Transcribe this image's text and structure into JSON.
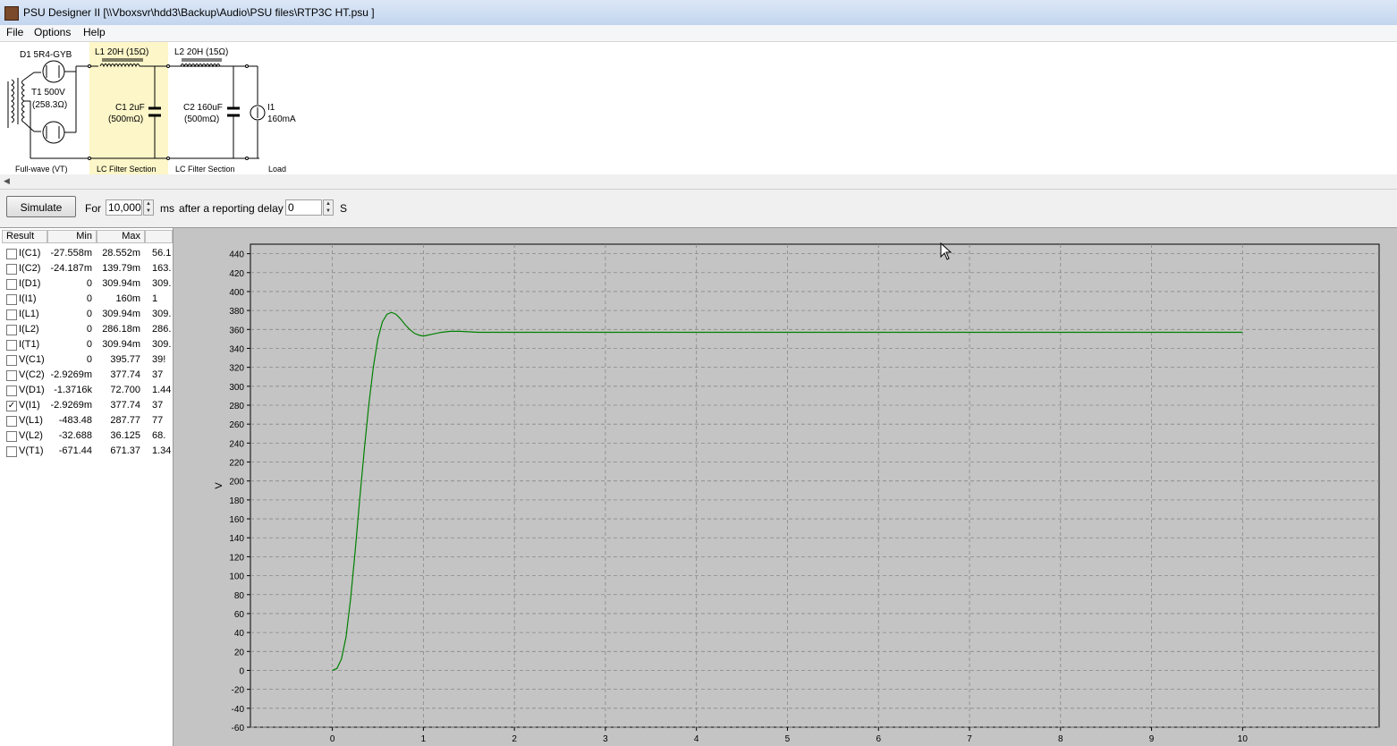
{
  "window": {
    "title": "PSU Designer II  [\\\\Vboxsvr\\hdd3\\Backup\\Audio\\PSU files\\RTP3C HT.psu ]",
    "icon": "app-icon"
  },
  "menu": [
    "File",
    "Options",
    "Help"
  ],
  "schematic": {
    "d1_label": "D1 5R4-GYB",
    "t1_label1": "T1 500V",
    "t1_label2": "(258.3Ω)",
    "l1_label": "L1 20H (15Ω)",
    "l2_label": "L2 20H (15Ω)",
    "c1_label1": "C1 2uF",
    "c1_label2": "(500mΩ)",
    "c2_label1": "C2 160uF",
    "c2_label2": "(500mΩ)",
    "i1_label1": "I1",
    "i1_label2": "160mA",
    "section_fullwave": "Full-wave (VT)",
    "section_lc1": "LC Filter Section",
    "section_lc2": "LC Filter Section",
    "section_load": "Load",
    "highlight_color": "#fcf6c8"
  },
  "toolbar": {
    "simulate_label": "Simulate",
    "for_label": "For",
    "duration_value": "10,000",
    "ms_label": "ms",
    "delay_label": "after a reporting delay of",
    "delay_value": "0",
    "s_label": "S"
  },
  "results": {
    "headers": [
      "Result",
      "Min",
      "Max"
    ],
    "rows": [
      {
        "name": "I(C1)",
        "min": "-27.558m",
        "max": "28.552m",
        "third": "56.1",
        "checked": false
      },
      {
        "name": "I(C2)",
        "min": "-24.187m",
        "max": "139.79m",
        "third": "163.",
        "checked": false
      },
      {
        "name": "I(D1)",
        "min": "0",
        "max": "309.94m",
        "third": "309.",
        "checked": false
      },
      {
        "name": "I(I1)",
        "min": "0",
        "max": "160m",
        "third": "1",
        "checked": false
      },
      {
        "name": "I(L1)",
        "min": "0",
        "max": "309.94m",
        "third": "309.",
        "checked": false
      },
      {
        "name": "I(L2)",
        "min": "0",
        "max": "286.18m",
        "third": "286.",
        "checked": false
      },
      {
        "name": "I(T1)",
        "min": "0",
        "max": "309.94m",
        "third": "309.",
        "checked": false
      },
      {
        "name": "V(C1)",
        "min": "0",
        "max": "395.77",
        "third": "39!",
        "checked": false
      },
      {
        "name": "V(C2)",
        "min": "-2.9269m",
        "max": "377.74",
        "third": "37",
        "checked": false
      },
      {
        "name": "V(D1)",
        "min": "-1.3716k",
        "max": "72.700",
        "third": "1.44",
        "checked": false
      },
      {
        "name": "V(I1)",
        "min": "-2.9269m",
        "max": "377.74",
        "third": "37",
        "checked": true
      },
      {
        "name": "V(L1)",
        "min": "-483.48",
        "max": "287.77",
        "third": "77",
        "checked": false
      },
      {
        "name": "V(L2)",
        "min": "-32.688",
        "max": "36.125",
        "third": "68.",
        "checked": false
      },
      {
        "name": "V(T1)",
        "min": "-671.44",
        "max": "671.37",
        "third": "1.34",
        "checked": false
      }
    ]
  },
  "chart_data": {
    "type": "line",
    "ylabel": "V",
    "xlabel": "",
    "xlim": [
      -0.9,
      11.5
    ],
    "ylim": [
      -60,
      450
    ],
    "xticks": [
      0,
      1,
      2,
      3,
      4,
      5,
      6,
      7,
      8,
      9,
      10
    ],
    "yticks": [
      -60,
      -40,
      -20,
      0,
      20,
      40,
      60,
      80,
      100,
      120,
      140,
      160,
      180,
      200,
      220,
      240,
      260,
      280,
      300,
      320,
      340,
      360,
      380,
      400,
      420,
      440
    ],
    "grid": true,
    "series": [
      {
        "color": "#008000",
        "x": [
          0,
          0.05,
          0.1,
          0.15,
          0.2,
          0.25,
          0.3,
          0.35,
          0.4,
          0.45,
          0.5,
          0.55,
          0.6,
          0.65,
          0.7,
          0.75,
          0.8,
          0.85,
          0.9,
          0.95,
          1.0,
          1.05,
          1.1,
          1.2,
          1.3,
          1.4,
          1.6,
          2,
          3,
          4,
          5,
          6,
          7,
          8,
          9,
          10
        ],
        "y": [
          0,
          2,
          12,
          35,
          75,
          125,
          180,
          232,
          280,
          320,
          350,
          368,
          376,
          378,
          376,
          371,
          365,
          360,
          356,
          354,
          353,
          354,
          355,
          357,
          358,
          358,
          357,
          357,
          357,
          357,
          357,
          357,
          357,
          357,
          357,
          357
        ]
      }
    ]
  }
}
